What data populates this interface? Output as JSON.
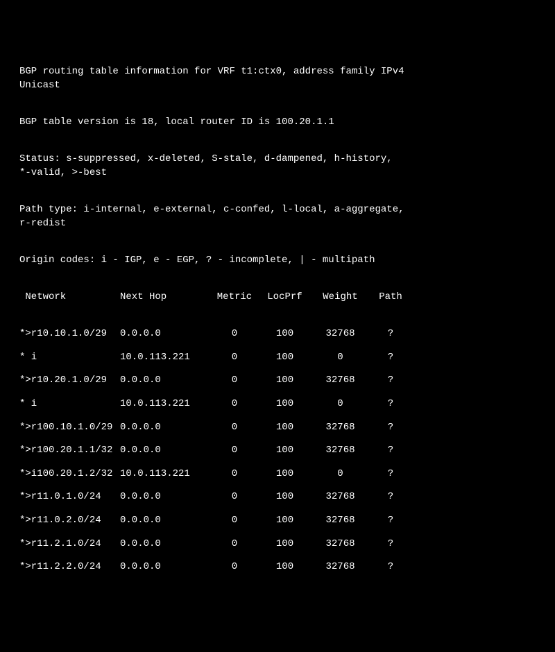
{
  "header": {
    "line1": "BGP routing table information for VRF t1:ctx0, address family IPv4",
    "line2": "Unicast",
    "version": "BGP table version is 18, local router ID is 100.20.1.1",
    "status1": "Status: s-suppressed, x-deleted, S-stale, d-dampened, h-history,",
    "status2": "*-valid, >-best",
    "pathtype1": "Path type: i-internal, e-external, c-confed, l-local, a-aggregate,",
    "pathtype2": "r-redist",
    "origin": "Origin codes: i - IGP, e - EGP, ? - incomplete, | - multipath"
  },
  "columns": {
    "network": " Network",
    "nexthop": "Next Hop",
    "metric": "Metric",
    "locprf": "LocPrf",
    "weight": "Weight",
    "path": "Path"
  },
  "routes": [
    {
      "network": "*>r10.10.1.0/29",
      "nexthop": "0.0.0.0",
      "metric": "0",
      "locprf": "100",
      "weight": "32768",
      "path": "?"
    },
    {
      "network": "* i",
      "nexthop": "10.0.113.221",
      "metric": "0",
      "locprf": "100",
      "weight": "0",
      "path": "?"
    },
    {
      "network": "*>r10.20.1.0/29",
      "nexthop": "0.0.0.0",
      "metric": "0",
      "locprf": "100",
      "weight": "32768",
      "path": "?"
    },
    {
      "network": "* i",
      "nexthop": "10.0.113.221",
      "metric": "0",
      "locprf": "100",
      "weight": "0",
      "path": "?"
    },
    {
      "network": "*>r100.10.1.0/29",
      "nexthop": "0.0.0.0",
      "metric": "0",
      "locprf": "100",
      "weight": "32768",
      "path": "?"
    },
    {
      "network": "*>r100.20.1.1/32",
      "nexthop": "0.0.0.0",
      "metric": "0",
      "locprf": "100",
      "weight": "32768",
      "path": "?"
    },
    {
      "network": "*>i100.20.1.2/32",
      "nexthop": "10.0.113.221",
      "metric": "0",
      "locprf": "100",
      "weight": "0",
      "path": "?"
    },
    {
      "network": "*>r11.0.1.0/24",
      "nexthop": "0.0.0.0",
      "metric": "0",
      "locprf": "100",
      "weight": "32768",
      "path": "?"
    },
    {
      "network": "*>r11.0.2.0/24",
      "nexthop": "0.0.0.0",
      "metric": "0",
      "locprf": "100",
      "weight": "32768",
      "path": "?"
    },
    {
      "network": "*>r11.2.1.0/24",
      "nexthop": "0.0.0.0",
      "metric": "0",
      "locprf": "100",
      "weight": "32768",
      "path": "?"
    },
    {
      "network": "*>r11.2.2.0/24",
      "nexthop": "0.0.0.0",
      "metric": "0",
      "locprf": "100",
      "weight": "32768",
      "path": "?"
    }
  ]
}
